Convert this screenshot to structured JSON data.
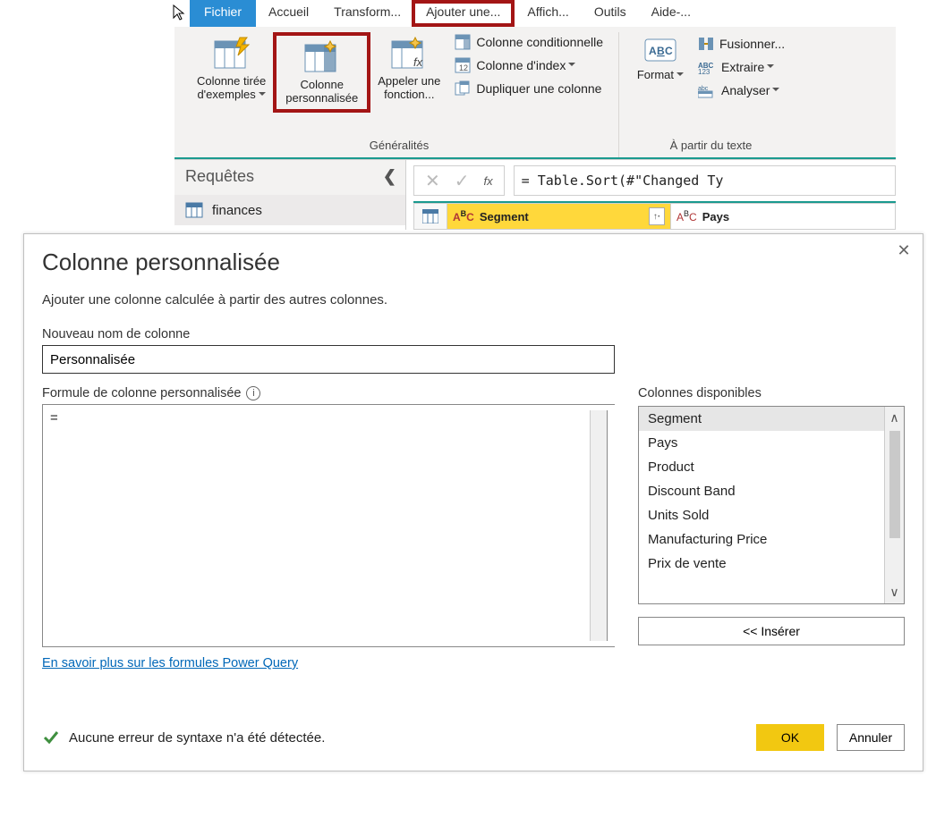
{
  "tabs": {
    "file": "Fichier",
    "home": "Accueil",
    "transform": "Transform...",
    "add": "Ajouter une...",
    "view": "Affich...",
    "tools": "Outils",
    "help": "Aide-..."
  },
  "ribbon": {
    "group_general": "Généralités",
    "group_text": "À partir du texte",
    "col_from_examples": "Colonne tirée\nd'exemples",
    "custom_column": "Colonne\npersonnalisée",
    "invoke_fn": "Appeler une\nfonction...",
    "cond_col": "Colonne conditionnelle",
    "index_col": "Colonne d'index",
    "dup_col": "Dupliquer une colonne",
    "format": "Format",
    "merge": "Fusionner...",
    "extract": "Extraire",
    "parse": "Analyser"
  },
  "queries": {
    "title": "Requêtes",
    "item1": "finances"
  },
  "formula_bar": {
    "fx": "fx",
    "text": "= Table.Sort(#\"Changed Ty"
  },
  "grid": {
    "col1": "Segment",
    "col2": "Pays",
    "type_prefix": "A",
    "type_suffix": "C",
    "type_b": "B"
  },
  "dialog": {
    "title": "Colonne personnalisée",
    "subtitle": "Ajouter une colonne calculée à partir des autres colonnes.",
    "new_col_label": "Nouveau nom de colonne",
    "new_col_value": "Personnalisée",
    "formula_label": "Formule de colonne personnalisée",
    "formula_value": "=",
    "available_label": "Colonnes disponibles",
    "available": [
      "Segment",
      "Pays",
      "Product",
      "Discount Band",
      "Units Sold",
      "Manufacturing Price",
      "Prix de vente"
    ],
    "insert": "<< Insérer",
    "learn_more": "En savoir plus sur les formules Power Query",
    "status": "Aucune erreur de syntaxe n'a été détectée.",
    "ok": "OK",
    "cancel": "Annuler"
  }
}
